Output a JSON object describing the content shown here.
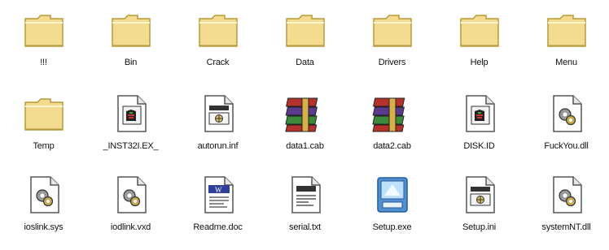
{
  "window": {
    "title": ""
  },
  "items": [
    {
      "label": "!!!",
      "type": "folder"
    },
    {
      "label": "Bin",
      "type": "folder"
    },
    {
      "label": "Crack",
      "type": "folder"
    },
    {
      "label": "Data",
      "type": "folder"
    },
    {
      "label": "Drivers",
      "type": "folder"
    },
    {
      "label": "Help",
      "type": "folder"
    },
    {
      "label": "Menu",
      "type": "folder"
    },
    {
      "label": "Temp",
      "type": "folder"
    },
    {
      "label": "_INST32I.EX_",
      "type": "setup-file"
    },
    {
      "label": "autorun.inf",
      "type": "ini"
    },
    {
      "label": "data1.cab",
      "type": "cab"
    },
    {
      "label": "data2.cab",
      "type": "cab"
    },
    {
      "label": "DISK.ID",
      "type": "setup-file"
    },
    {
      "label": "FuckYou.dll",
      "type": "system"
    },
    {
      "label": "ioslink.sys",
      "type": "system"
    },
    {
      "label": "iodlink.vxd",
      "type": "system"
    },
    {
      "label": "Readme.doc",
      "type": "doc"
    },
    {
      "label": "serial.txt",
      "type": "txt"
    },
    {
      "label": "Setup.exe",
      "type": "exe"
    },
    {
      "label": "Setup.ini",
      "type": "ini"
    },
    {
      "label": "systemNT.dll",
      "type": "system"
    }
  ],
  "colors": {
    "folder_fill": "#f3dc8f",
    "folder_edge": "#b89a3c",
    "exe_blue": "#4f8fd4",
    "cab_red": "#b5322c",
    "cab_green": "#3b8a3a",
    "cab_purple": "#5a3a8c"
  }
}
